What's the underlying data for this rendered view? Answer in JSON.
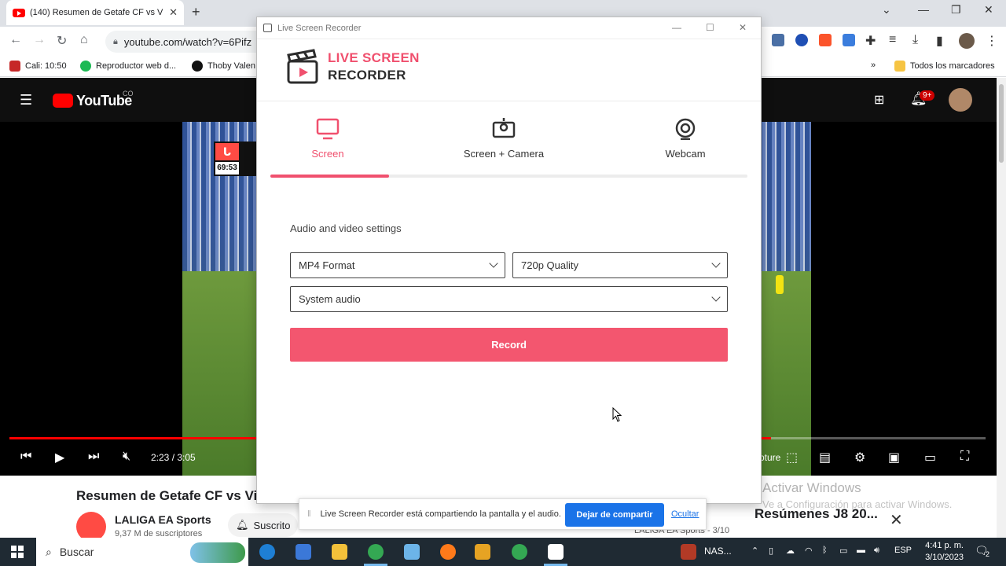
{
  "browser": {
    "tab_title": "(140) Resumen de Getafe CF vs V",
    "url": "youtube.com/watch?v=6Pifz",
    "bookmarks": [
      "Cali: 10:50",
      "Reproductor web d...",
      "Thoby Valen"
    ],
    "bookmarks_folder": "Todos los marcadores",
    "more_bookmarks": "»"
  },
  "youtube": {
    "logo": "YouTube",
    "country": "CO",
    "notifications": "9+",
    "time": "2:23 / 3:05",
    "progress_fraction": 0.78,
    "scorebug_time": "69:53",
    "video_title": "Resumen de Getafe CF vs Vill",
    "channel": "LALIGA EA Sports",
    "subscribers": "9,37 M de suscriptores",
    "subscribe_label": "Suscrito",
    "side_title": "Resúmenes J8 20...",
    "side_channel": "LALIGA EA Sports - 3/10",
    "capture_label": "pture"
  },
  "watermark": {
    "title": "Activar Windows",
    "subtitle": "Ve a Configuración para activar Windows."
  },
  "recorder": {
    "window_title": "Live Screen Recorder",
    "brand_line1": "LIVE SCREEN",
    "brand_line2": "RECORDER",
    "modes": [
      {
        "label": "Screen",
        "icon": "monitor-icon",
        "active": true
      },
      {
        "label": "Screen + Camera",
        "icon": "screen-camera-icon",
        "active": false
      },
      {
        "label": "Webcam",
        "icon": "webcam-icon",
        "active": false
      }
    ],
    "settings_label": "Audio and video settings",
    "format": "MP4 Format",
    "quality": "720p Quality",
    "audio": "System audio",
    "record_label": "Record",
    "accent": "#f0506e"
  },
  "share_bar": {
    "message": "Live Screen Recorder está compartiendo la pantalla y el audio.",
    "stop_label": "Dejar de compartir",
    "hide_label": "Ocultar"
  },
  "taskbar": {
    "search_placeholder": "Buscar",
    "nas_label": "NAS...",
    "language": "ESP",
    "time": "4:41 p. m.",
    "date": "3/10/2023",
    "notification_count": "2"
  }
}
